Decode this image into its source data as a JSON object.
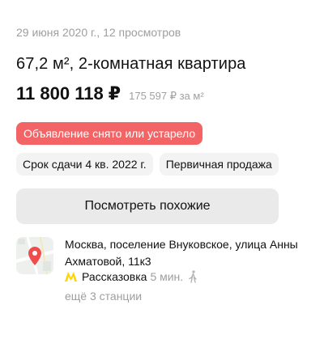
{
  "listing": {
    "meta": "29 июня 2020 г., 12 просмотров",
    "title": "67,2 м², 2-комнатная квартира",
    "price": "11 800 118 ₽",
    "price_per_sqm": "175 597 ₽ за м²",
    "status_badge": "Объявление снято или устарело",
    "tags": [
      "Срок сдачи 4 кв. 2022 г.",
      "Первичная продажа"
    ],
    "similar_button": "Посмотреть похожие"
  },
  "location": {
    "address": "Москва, поселение Внуковское, улица Анны Ахматовой, 11к3",
    "metro": {
      "station": "Рассказовка",
      "time": "5 мин."
    },
    "more_stations": "ещё 3 станции"
  },
  "colors": {
    "badge_bg": "#f26466",
    "metro_line": "#ffd600",
    "map_pin": "#f04c4c"
  },
  "icons": {
    "map": "map-pin-icon",
    "metro": "metro-m-icon",
    "walk": "walking-person-icon"
  }
}
